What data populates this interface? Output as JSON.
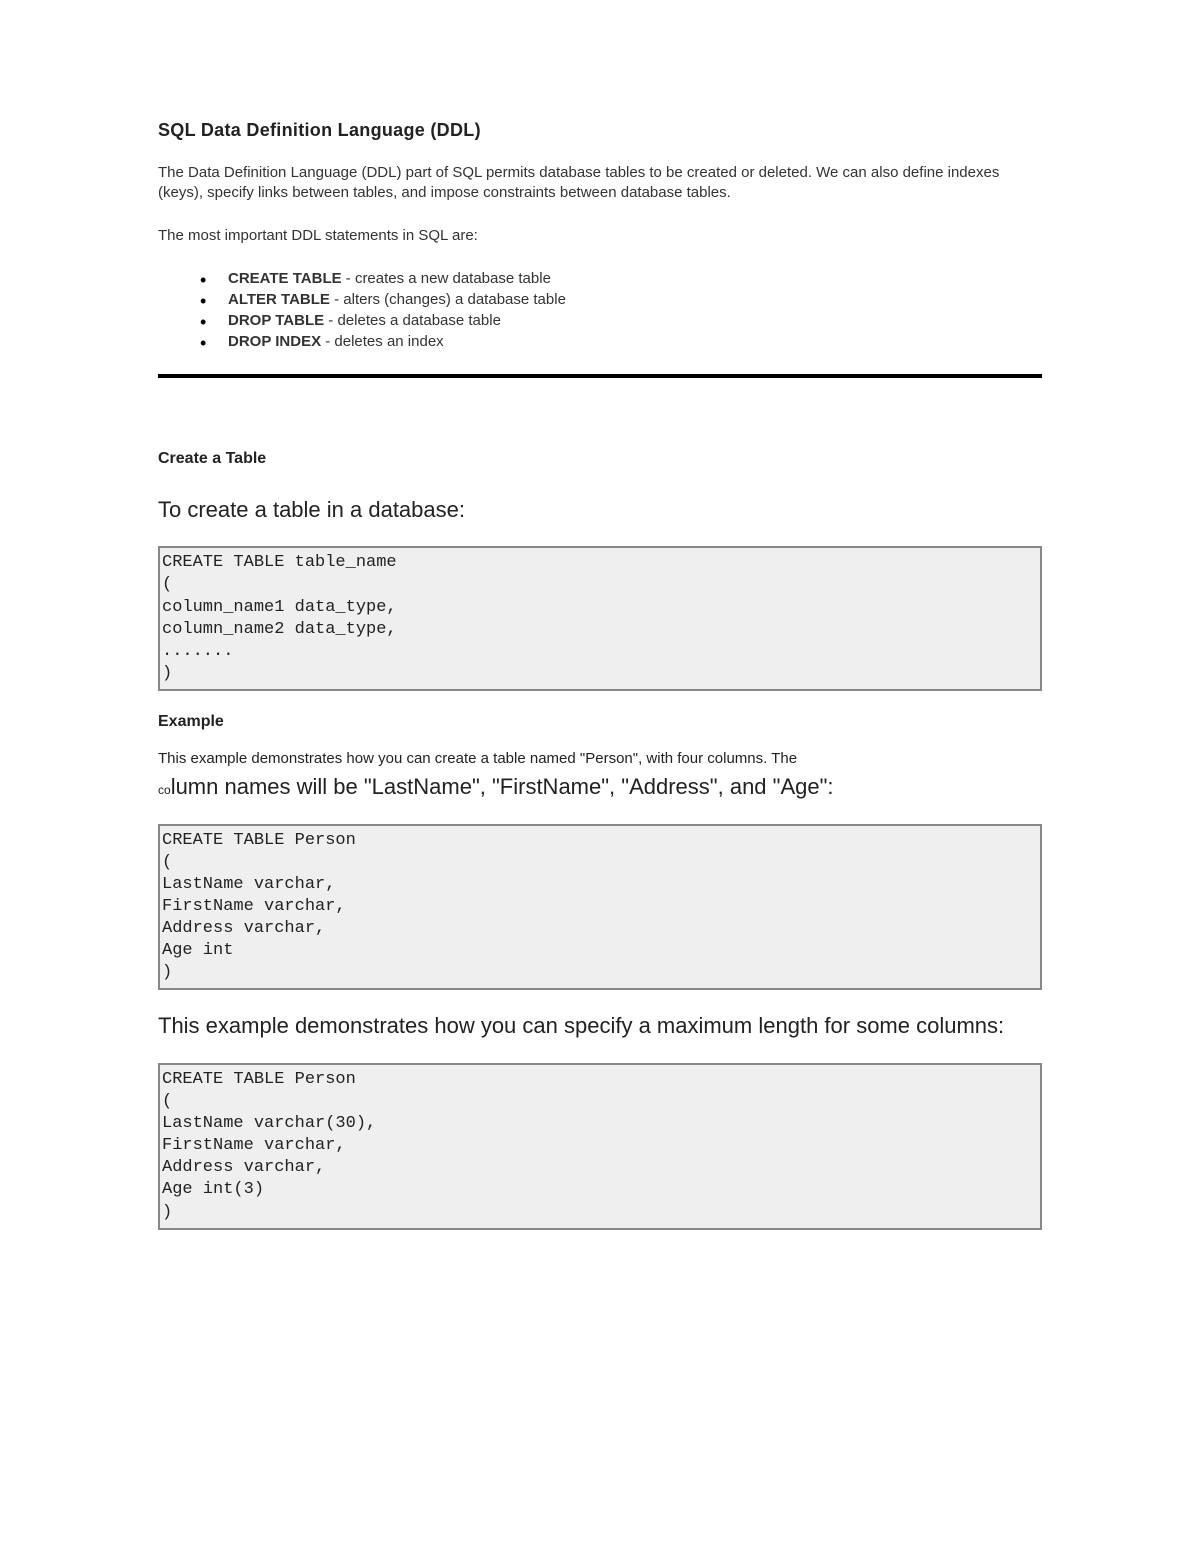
{
  "heading_main": "SQL Data Definition Language (DDL)",
  "intro_p1": "The Data Definition Language (DDL) part of SQL permits database tables to be created or deleted. We can also define indexes (keys), specify links between tables, and impose constraints between database tables.",
  "intro_p2": "The most important DDL statements in SQL are:",
  "bullets": [
    {
      "term": "CREATE TABLE",
      "desc": " - creates a new database table"
    },
    {
      "term": "ALTER TABLE",
      "desc": " - alters (changes) a database table"
    },
    {
      "term": "DROP TABLE",
      "desc": " - deletes a database table"
    },
    {
      "term": "DROP INDEX",
      "desc": " - deletes an index"
    }
  ],
  "heading_create": "Create a Table",
  "heading_tocreate": "To create a table in a database:",
  "code1": "CREATE TABLE table_name\n(\ncolumn_name1 data_type,\ncolumn_name2 data_type,\n.......\n)",
  "heading_example": "Example",
  "example_p1_a": "This example demonstrates how you can create a table named \"Person\", with four columns. The ",
  "example_p1_b_prefix": "co",
  "example_p1_b_rest": "lumn names will be \"LastName\", \"FirstName\", \"Address\", and \"Age\":",
  "code2": "CREATE TABLE Person\n(\nLastName varchar,\nFirstName varchar,\nAddress varchar,\nAge int\n)",
  "example_p2": "This example demonstrates how you can specify a maximum length for some columns:",
  "code3": "CREATE TABLE Person\n(\nLastName varchar(30),\nFirstName varchar,\nAddress varchar,\nAge int(3)\n)"
}
